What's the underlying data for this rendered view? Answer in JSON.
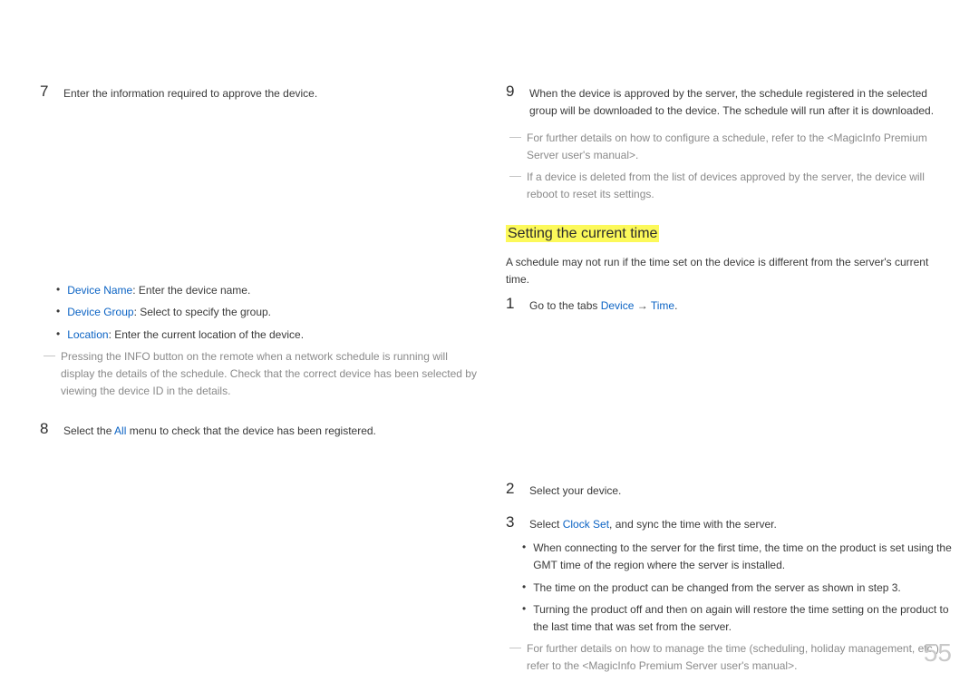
{
  "left": {
    "step7": {
      "num": "7",
      "text": "Enter the information required to approve the device."
    },
    "bullets": [
      {
        "link": "Device Name",
        "rest": ": Enter the device name."
      },
      {
        "link": "Device Group",
        "rest": ": Select    to specify the group."
      },
      {
        "link": "Location",
        "rest": ": Enter the current location of the device."
      }
    ],
    "dash1": "Pressing the INFO button on the remote when a network schedule is running will display the details of the schedule. Check that the correct device has been selected by viewing the device ID in the details.",
    "step8": {
      "num": "8",
      "pre": "Select the ",
      "link": "All",
      "post": " menu to check that the device has been registered."
    }
  },
  "right": {
    "step9": {
      "num": "9",
      "text": "When the device is approved by the server, the schedule registered in the selected group will be downloaded to the device. The schedule will run after it is downloaded."
    },
    "dash1": "For further details on how to configure a schedule, refer to the <MagicInfo Premium Server user's manual>.",
    "dash2": "If a device is deleted from the list of devices approved by the server, the device will reboot to reset its settings.",
    "heading": "Setting the current time",
    "intro": "A schedule may not run if the time set on the device is different from the server's current time.",
    "step1": {
      "num": "1",
      "pre": "Go to the tabs ",
      "link1": "Device",
      "arrow": " → ",
      "link2": "Time",
      "post": "."
    },
    "step2": {
      "num": "2",
      "text": "Select your device."
    },
    "step3": {
      "num": "3",
      "pre": "Select ",
      "link": "Clock Set",
      "post": ", and sync the time with the server."
    },
    "bullets2": [
      "When connecting to the server for the first time, the time on the product is set using the GMT time of the region where the server is installed.",
      "The time on the product can be changed from the server as shown in step 3.",
      "Turning the product off and then on again will restore the time setting on the product to the last time that was set from the server."
    ],
    "dash3": "For further details on how to manage the time (scheduling, holiday management, etc.), refer to the <MagicInfo Premium Server user's manual>."
  },
  "pageNumber": "55"
}
